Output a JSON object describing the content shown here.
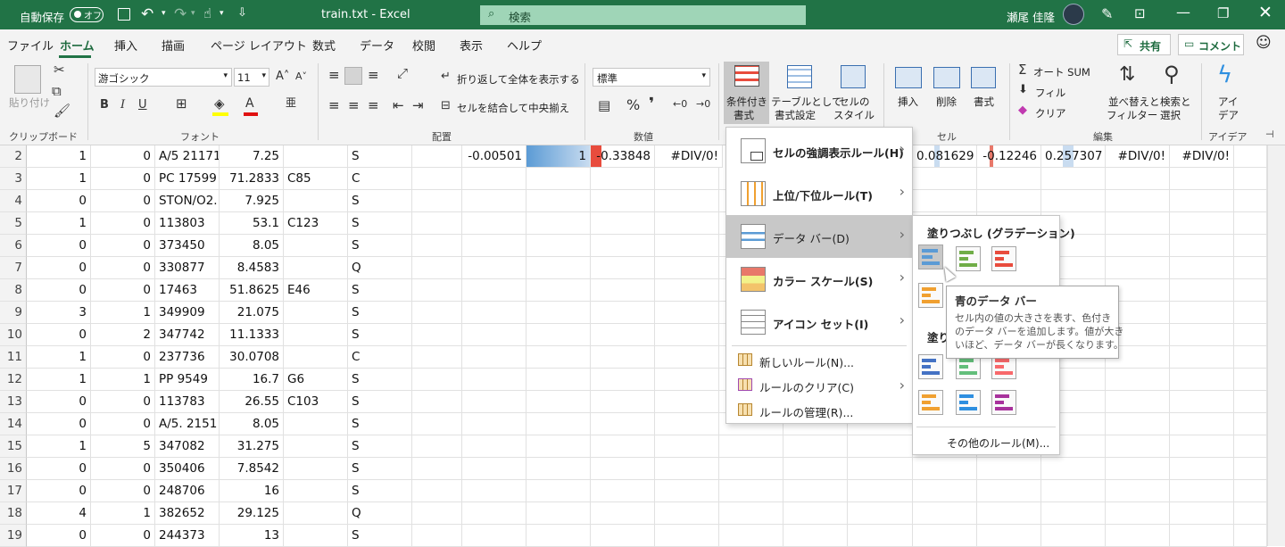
{
  "titlebar": {
    "autosave": "自動保存",
    "toggle": "オフ",
    "filename": "train.txt  -  Excel",
    "search_placeholder": "検索",
    "user": "瀬尾 佳隆"
  },
  "menu": {
    "tabs": [
      "ファイル",
      "ホーム",
      "挿入",
      "描画",
      "ページ レイアウト",
      "数式",
      "データ",
      "校閲",
      "表示",
      "ヘルプ"
    ],
    "active": "ホーム",
    "share": "共有",
    "comment": "コメント"
  },
  "ribbon": {
    "clipboard": {
      "paste": "貼り付け",
      "label": "クリップボード"
    },
    "font": {
      "name": "游ゴシック",
      "size": "11",
      "label": "フォント"
    },
    "alignment": {
      "wrap": "折り返して全体を表示する",
      "merge": "セルを結合して中央揃え",
      "label": "配置"
    },
    "number": {
      "format": "標準",
      "label": "数値"
    },
    "styles": {
      "conditional": [
        "条件付き",
        "書式"
      ],
      "table": [
        "テーブルとして",
        "書式設定"
      ],
      "cellstyle": [
        "セルの",
        "スタイル"
      ]
    },
    "cells": {
      "insert": "挿入",
      "delete": "削除",
      "format": "書式",
      "label": "セル"
    },
    "editing": {
      "autosum": "オート SUM",
      "fill": "フィル",
      "clear": "クリア",
      "sort": [
        "並べ替えと",
        "フィルター"
      ],
      "find": [
        "検索と",
        "選択"
      ],
      "label": "編集"
    },
    "ideas": {
      "title": [
        "アイ",
        "デア"
      ],
      "label": "アイデア"
    }
  },
  "grid": {
    "rows": [
      {
        "n": "2",
        "c": [
          "1",
          "0",
          "A/5 21171",
          "7.25",
          "",
          "S"
        ]
      },
      {
        "n": "3",
        "c": [
          "1",
          "0",
          "PC 17599",
          "71.2833",
          "C85",
          "C"
        ]
      },
      {
        "n": "4",
        "c": [
          "0",
          "0",
          "STON/O2.",
          "7.925",
          "",
          "S"
        ]
      },
      {
        "n": "5",
        "c": [
          "1",
          "0",
          "113803",
          "53.1",
          "C123",
          "S"
        ]
      },
      {
        "n": "6",
        "c": [
          "0",
          "0",
          "373450",
          "8.05",
          "",
          "S"
        ]
      },
      {
        "n": "7",
        "c": [
          "0",
          "0",
          "330877",
          "8.4583",
          "",
          "Q"
        ]
      },
      {
        "n": "8",
        "c": [
          "0",
          "0",
          "17463",
          "51.8625",
          "E46",
          "S"
        ]
      },
      {
        "n": "9",
        "c": [
          "3",
          "1",
          "349909",
          "21.075",
          "",
          "S"
        ]
      },
      {
        "n": "10",
        "c": [
          "0",
          "2",
          "347742",
          "11.1333",
          "",
          "S"
        ]
      },
      {
        "n": "11",
        "c": [
          "1",
          "0",
          "237736",
          "30.0708",
          "",
          "C"
        ]
      },
      {
        "n": "12",
        "c": [
          "1",
          "1",
          "PP 9549",
          "16.7",
          "G6",
          "S"
        ]
      },
      {
        "n": "13",
        "c": [
          "0",
          "0",
          "113783",
          "26.55",
          "C103",
          "S"
        ]
      },
      {
        "n": "14",
        "c": [
          "0",
          "0",
          "A/5. 2151",
          "8.05",
          "",
          "S"
        ]
      },
      {
        "n": "15",
        "c": [
          "1",
          "5",
          "347082",
          "31.275",
          "",
          "S"
        ]
      },
      {
        "n": "16",
        "c": [
          "0",
          "0",
          "350406",
          "7.8542",
          "",
          "S"
        ]
      },
      {
        "n": "17",
        "c": [
          "0",
          "0",
          "248706",
          "16",
          "",
          "S"
        ]
      },
      {
        "n": "18",
        "c": [
          "4",
          "1",
          "382652",
          "29.125",
          "",
          "Q"
        ]
      },
      {
        "n": "19",
        "c": [
          "0",
          "0",
          "244373",
          "13",
          "",
          "S"
        ]
      }
    ],
    "row2_extra": {
      "left": [
        "-0.00501",
        "1",
        "-0.33848",
        "#DIV/0!"
      ],
      "right": [
        "0.081629",
        "-0.12246",
        "0.257307",
        "#DIV/0!",
        "#DIV/0!"
      ]
    }
  },
  "cf_menu": {
    "items": [
      "セルの強調表示ルール(H)",
      "上位/下位ルール(T)",
      "データ バー(D)",
      "カラー スケール(S)",
      "アイコン セット(I)"
    ],
    "small": [
      "新しいルール(N)...",
      "ルールのクリア(C)",
      "ルールの管理(R)..."
    ]
  },
  "databar_menu": {
    "gradient_title": "塗りつぶし (グラデーション)",
    "solid_title": "塗り",
    "more": "その他のルール(M)..."
  },
  "tooltip": {
    "title": "青のデータ バー",
    "body": [
      "セル内の値の大きさを表す、色付き",
      "のデータ バーを追加します。値が大き",
      "いほど、データ バーが長くなります。"
    ]
  },
  "colors": {
    "excel_green": "#217346",
    "blue": "#5b9bd5",
    "green": "#70ad47",
    "red": "#e84c3d",
    "orange": "#f0a030",
    "sky": "#2e8fe0",
    "purple": "#a8329c"
  }
}
